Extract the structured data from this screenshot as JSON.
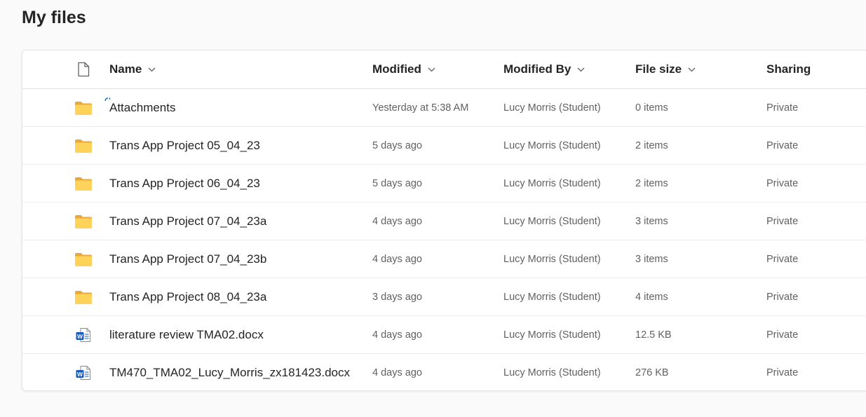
{
  "page": {
    "title": "My files"
  },
  "columns": {
    "type_icon": "document-icon",
    "name": "Name",
    "modified": "Modified",
    "modified_by": "Modified By",
    "file_size": "File size",
    "sharing": "Sharing"
  },
  "colors": {
    "folder": "#F5C542",
    "word": "#185ABD",
    "background": "#FAFAFA",
    "accent": "#0F6CBD"
  },
  "files": [
    {
      "icon": "folder-icon",
      "name": "Attachments",
      "modified": "Yesterday at 5:38 AM",
      "modified_by": "Lucy Morris (Student)",
      "size": "0 items",
      "sharing": "Private",
      "syncing": true
    },
    {
      "icon": "folder-icon",
      "name": "Trans App Project 05_04_23",
      "modified": "5 days ago",
      "modified_by": "Lucy Morris (Student)",
      "size": "2 items",
      "sharing": "Private"
    },
    {
      "icon": "folder-icon",
      "name": "Trans App Project 06_04_23",
      "modified": "5 days ago",
      "modified_by": "Lucy Morris (Student)",
      "size": "2 items",
      "sharing": "Private"
    },
    {
      "icon": "folder-icon",
      "name": "Trans App Project 07_04_23a",
      "modified": "4 days ago",
      "modified_by": "Lucy Morris (Student)",
      "size": "3 items",
      "sharing": "Private"
    },
    {
      "icon": "folder-icon",
      "name": "Trans App Project 07_04_23b",
      "modified": "4 days ago",
      "modified_by": "Lucy Morris (Student)",
      "size": "3 items",
      "sharing": "Private"
    },
    {
      "icon": "folder-icon",
      "name": "Trans App Project 08_04_23a",
      "modified": "3 days ago",
      "modified_by": "Lucy Morris (Student)",
      "size": "4 items",
      "sharing": "Private"
    },
    {
      "icon": "word-doc-icon",
      "name": "literature review TMA02.docx",
      "modified": "4 days ago",
      "modified_by": "Lucy Morris (Student)",
      "size": "12.5 KB",
      "sharing": "Private"
    },
    {
      "icon": "word-doc-icon",
      "name": "TM470_TMA02_Lucy_Morris_zx181423.docx",
      "modified": "4 days ago",
      "modified_by": "Lucy Morris (Student)",
      "size": "276 KB",
      "sharing": "Private"
    }
  ]
}
